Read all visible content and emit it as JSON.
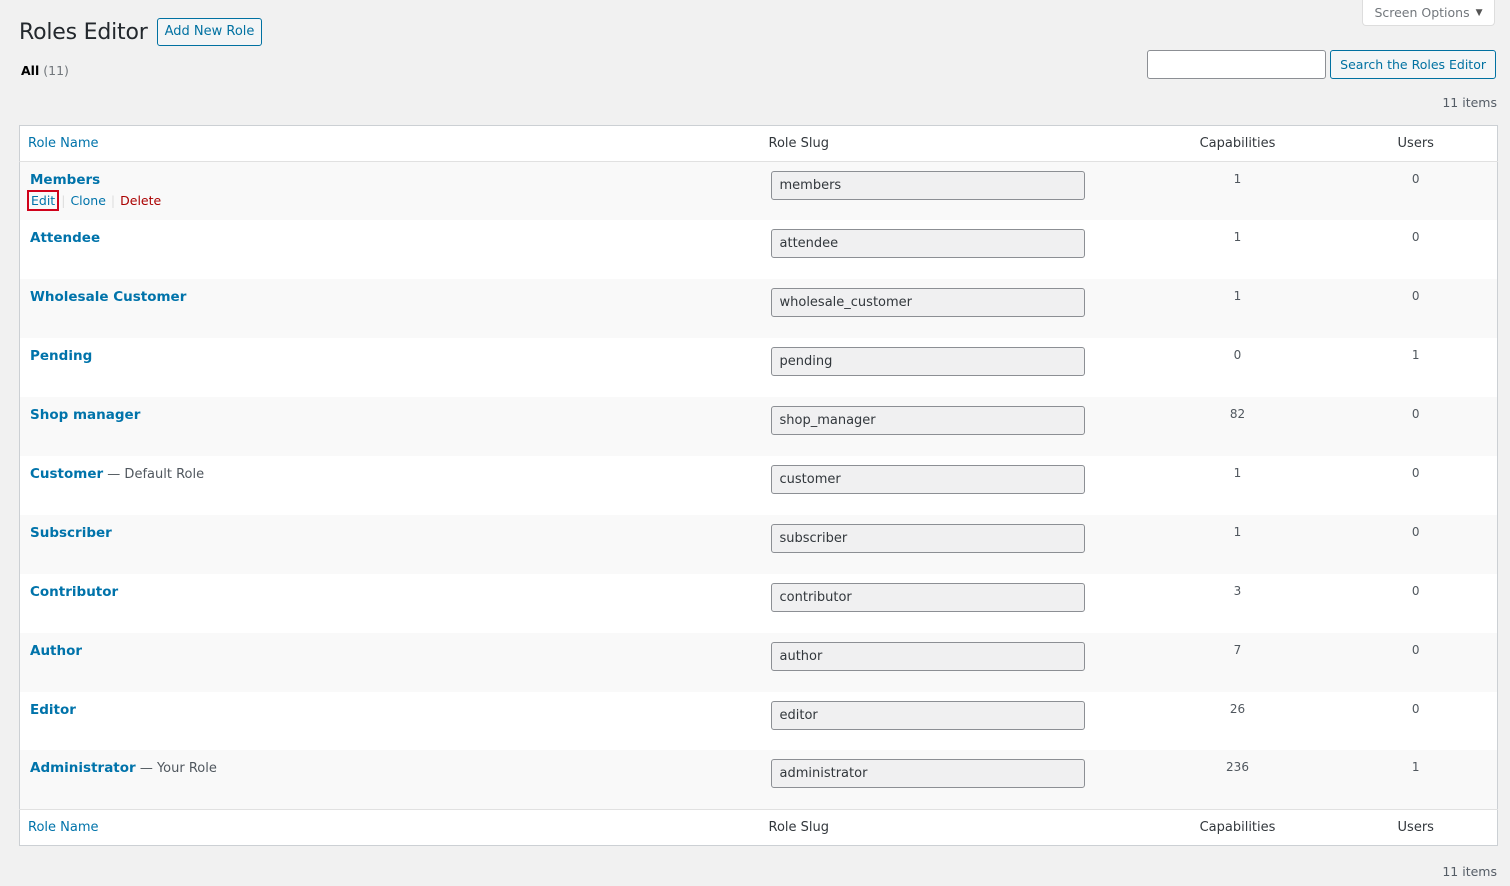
{
  "screen_options": {
    "label": "Screen Options",
    "arrow_icon": "▼"
  },
  "header": {
    "title": "Roles Editor",
    "add_new_label": "Add New Role"
  },
  "filters": {
    "all_label": "All",
    "all_count": "(11)"
  },
  "search": {
    "value": "",
    "button_label": "Search the Roles Editor"
  },
  "items_count": "11 items",
  "columns": {
    "role_name": "Role Name",
    "role_slug": "Role Slug",
    "capabilities": "Capabilities",
    "users": "Users"
  },
  "row_actions": {
    "edit": "Edit",
    "clone": "Clone",
    "delete": "Delete",
    "separator": "|"
  },
  "roles": [
    {
      "name": "Members",
      "suffix": "",
      "slug": "members",
      "capabilities": "1",
      "users": "0"
    },
    {
      "name": "Attendee",
      "suffix": "",
      "slug": "attendee",
      "capabilities": "1",
      "users": "0"
    },
    {
      "name": "Wholesale Customer",
      "suffix": "",
      "slug": "wholesale_customer",
      "capabilities": "1",
      "users": "0"
    },
    {
      "name": "Pending",
      "suffix": "",
      "slug": "pending",
      "capabilities": "0",
      "users": "1"
    },
    {
      "name": "Shop manager",
      "suffix": "",
      "slug": "shop_manager",
      "capabilities": "82",
      "users": "0"
    },
    {
      "name": "Customer",
      "suffix": " — Default Role",
      "slug": "customer",
      "capabilities": "1",
      "users": "0"
    },
    {
      "name": "Subscriber",
      "suffix": "",
      "slug": "subscriber",
      "capabilities": "1",
      "users": "0"
    },
    {
      "name": "Contributor",
      "suffix": "",
      "slug": "contributor",
      "capabilities": "3",
      "users": "0"
    },
    {
      "name": "Author",
      "suffix": "",
      "slug": "author",
      "capabilities": "7",
      "users": "0"
    },
    {
      "name": "Editor",
      "suffix": "",
      "slug": "editor",
      "capabilities": "26",
      "users": "0"
    },
    {
      "name": "Administrator",
      "suffix": " — Your Role",
      "slug": "administrator",
      "capabilities": "236",
      "users": "1"
    }
  ],
  "colors": {
    "link": "#0073aa",
    "delete": "#a00",
    "highlight": "#d0021b"
  }
}
